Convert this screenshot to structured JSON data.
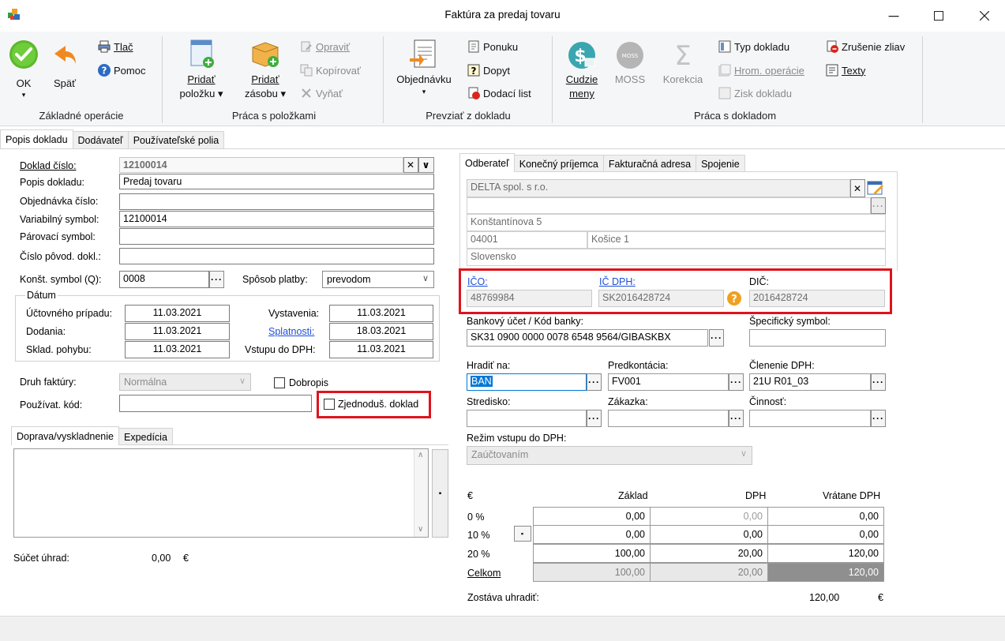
{
  "window": {
    "title": "Faktúra za predaj tovaru"
  },
  "ribbon": {
    "groups": {
      "basic": "Základné operácie",
      "items": "Práca s položkami",
      "take": "Prevziať z dokladu",
      "doc": "Práca s dokladom"
    },
    "ok": "OK",
    "back": "Späť",
    "print": "Tlač",
    "help": "Pomoc",
    "add_item_1": "Pridať",
    "add_item_2": "položku",
    "add_stock_1": "Pridať",
    "add_stock_2": "zásobu",
    "edit": "Opraviť",
    "copy": "Kopírovať",
    "cut": "Vyňať",
    "order": "Objednávku",
    "offer": "Ponuku",
    "inquiry": "Dopyt",
    "delivery": "Dodací list",
    "foreign_1": "Cudzie",
    "foreign_2": "meny",
    "moss": "MOSS",
    "correction": "Korekcia",
    "doc_type": "Typ dokladu",
    "bulk_ops": "Hrom. operácie",
    "doc_profit": "Zisk dokladu",
    "cancel_disc": "Zrušenie zliav",
    "texts": "Texty"
  },
  "main_tabs": [
    "Popis dokladu",
    "Dodávateľ",
    "Používateľské polia"
  ],
  "left": {
    "doc_no_label": "Doklad číslo:",
    "doc_no": "12100014",
    "desc_label": "Popis dokladu:",
    "desc": "Predaj tovaru",
    "order_label": "Objednávka číslo:",
    "order": "",
    "var_label": "Variabilný symbol:",
    "var": "12100014",
    "pair_label": "Párovací symbol:",
    "pair": "",
    "orig_label": "Číslo pôvod. dokl.:",
    "orig": "",
    "const_label": "Konšt. symbol (Q):",
    "const": "0008",
    "pay_label": "Spôsob platby:",
    "pay": "prevodom",
    "dates_legend": "Dátum",
    "acc_label": "Účtovného prípadu:",
    "acc": "11.03.2021",
    "deliv_label": "Dodania:",
    "deliv": "11.03.2021",
    "stock_label": "Sklad. pohybu:",
    "stock": "11.03.2021",
    "issue_label": "Vystavenia:",
    "issue": "11.03.2021",
    "due_label": "Splatnosti:",
    "due": "18.03.2021",
    "vat_in_label": "Vstupu do DPH:",
    "vat_in": "11.03.2021",
    "kind_label": "Druh faktúry:",
    "kind": "Normálna",
    "credit_note": "Dobropis",
    "user_code_label": "Používat. kód:",
    "user_code": "",
    "simplified": "Zjednoduš. doklad",
    "sub_tabs": [
      "Doprava/vyskladnenie",
      "Expedícia"
    ],
    "sum_label": "Súčet úhrad:",
    "sum": "0,00",
    "sum_cur": "€"
  },
  "right": {
    "tabs": [
      "Odberateľ",
      "Konečný príjemca",
      "Fakturačná adresa",
      "Spojenie"
    ],
    "name": "DELTA spol. s r.o.",
    "street": "Konštantínova 5",
    "zip": "04001",
    "city": "Košice 1",
    "country": "Slovensko",
    "ico_label": "IČO:",
    "ico": "48769984",
    "icdph_label": "IČ DPH:",
    "icdph": "SK2016428724",
    "dic_label": "DIČ:",
    "dic": "2016428724",
    "bank_label": "Bankový účet / Kód banky:",
    "bank": "SK31 0900 0000 0078 6548 9564/GIBASKBX",
    "spec_label": "Špecifický symbol:",
    "spec": "",
    "payby_label": "Hradiť na:",
    "payby": "BAN",
    "precont_label": "Predkontácia:",
    "precont": "FV001",
    "vatsplit_label": "Členenie DPH:",
    "vatsplit": "21U R01_03",
    "center_label": "Stredisko:",
    "job_label": "Zákazka:",
    "activity_label": "Činnosť:",
    "vatmode_label": "Režim vstupu do DPH:",
    "vatmode": "Zaúčtovaním",
    "currency": "€",
    "col_base": "Základ",
    "col_vat": "DPH",
    "col_total": "Vrátane DPH",
    "rows": [
      {
        "label": "0 %",
        "base": "0,00",
        "vat": "0,00",
        "total": "0,00"
      },
      {
        "label": "10 %",
        "base": "0,00",
        "vat": "0,00",
        "total": "0,00"
      },
      {
        "label": "20 %",
        "base": "100,00",
        "vat": "20,00",
        "total": "120,00"
      }
    ],
    "total_label": "Celkom",
    "total_base": "100,00",
    "total_vat": "20,00",
    "total_total": "120,00",
    "remain_label": "Zostáva uhradiť:",
    "remain": "120,00",
    "remain_cur": "€"
  }
}
